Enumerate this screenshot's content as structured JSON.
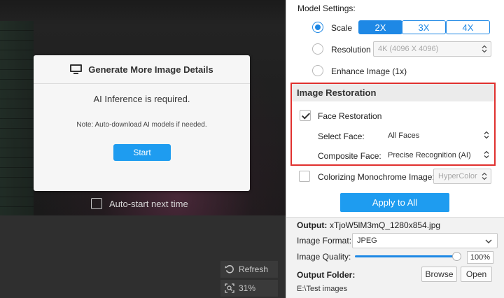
{
  "preview": {
    "dialog": {
      "title": "Generate More Image Details",
      "requirement": "AI Inference is required.",
      "note": "Note: Auto-download AI models if needed.",
      "start_label": "Start"
    },
    "autostart_label": "Auto-start next time",
    "autostart_checked": false,
    "refresh_label": "Refresh",
    "zoom_label": "31%"
  },
  "settings": {
    "model_settings_label": "Model Settings:",
    "scale": {
      "label": "Scale",
      "selected": true,
      "options": [
        "2X",
        "3X",
        "4X"
      ],
      "active": "2X"
    },
    "resolution": {
      "label": "Resolution",
      "selected": false,
      "value": "4K (4096 X 4096)"
    },
    "enhance": {
      "label": "Enhance Image (1x)",
      "selected": false
    },
    "image_restoration": {
      "heading": "Image Restoration",
      "face_restoration_label": "Face Restoration",
      "face_restoration_checked": true,
      "select_face_label": "Select Face:",
      "select_face_value": "All Faces",
      "composite_face_label": "Composite Face:",
      "composite_face_value": "Precise Recognition (AI)",
      "highlight_color": "#e0302e"
    },
    "colorizing": {
      "label": "Colorizing Monochrome Image:",
      "checked": false,
      "value": "HyperColor"
    },
    "apply_all_label": "Apply to All"
  },
  "output": {
    "label": "Output:",
    "filename": "xTjoW5lM3mQ_1280x854.jpg",
    "format_label": "Image Format:",
    "format_value": "JPEG",
    "quality_label": "Image Quality:",
    "quality_value": "100%",
    "quality_fraction": 1.0,
    "folder_label": "Output Folder:",
    "browse_label": "Browse",
    "open_label": "Open",
    "folder_path": "E:\\Test images"
  },
  "colors": {
    "accent": "#1e88e5",
    "start_button": "#1e9cf0",
    "restoration_border": "#e0302e"
  }
}
